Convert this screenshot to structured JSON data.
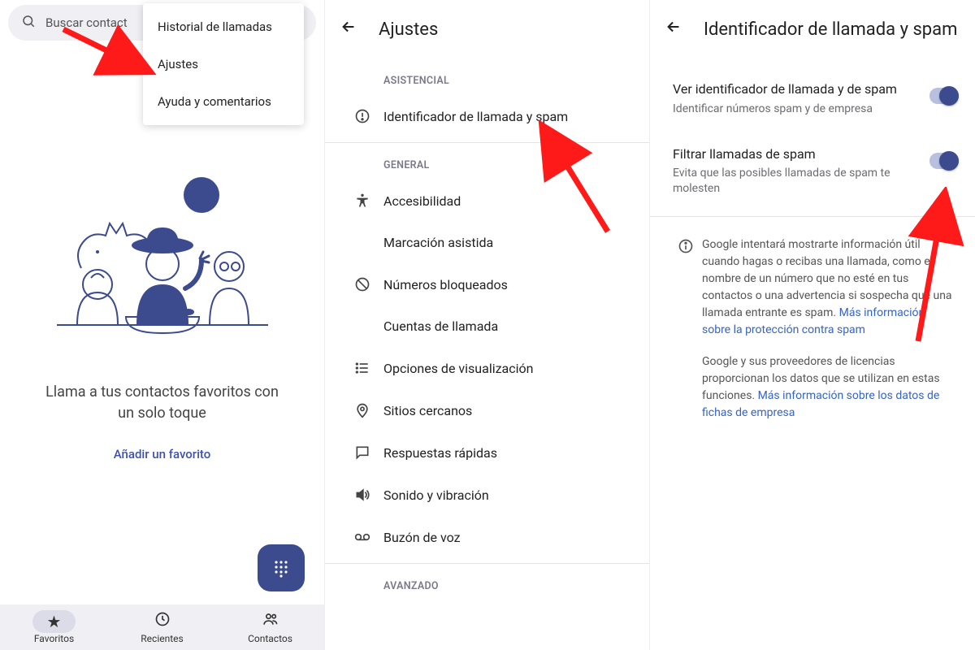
{
  "panel1": {
    "search_placeholder": "Buscar contact",
    "menu": {
      "history": "Historial de llamadas",
      "settings": "Ajustes",
      "help": "Ayuda y comentarios"
    },
    "favorites_message": "Llama a tus contactos favoritos con un solo toque",
    "add_favorite": "Añadir un favorito",
    "nav": {
      "favorites": "Favoritos",
      "recent": "Recientes",
      "contacts": "Contactos"
    }
  },
  "panel2": {
    "title": "Ajustes",
    "sections": {
      "assist": "ASISTENCIAL",
      "general": "GENERAL",
      "advanced": "AVANZADO"
    },
    "items": {
      "caller_id_spam": "Identificador de llamada y spam",
      "accessibility": "Accesibilidad",
      "assisted_dialing": "Marcación asistida",
      "blocked_numbers": "Números bloqueados",
      "calling_accounts": "Cuentas de llamada",
      "display_options": "Opciones de visualización",
      "nearby_places": "Sitios cercanos",
      "quick_responses": "Respuestas rápidas",
      "sound_vibration": "Sonido y vibración",
      "voicemail": "Buzón de voz"
    }
  },
  "panel3": {
    "title": "Identificador de llamada y spam",
    "toggle1": {
      "title": "Ver identificador de llamada y de spam",
      "sub": "Identificar números spam y de empresa"
    },
    "toggle2": {
      "title": "Filtrar llamadas de spam",
      "sub": "Evita que las posibles llamadas de spam te molesten"
    },
    "info": {
      "p1a": "Google intentará mostrarte información útil cuando hagas o recibas una llamada, como el nombre de un número que no esté en tus contactos o una advertencia si sospecha que una llamada entrante es spam. ",
      "p1_link": "Más información sobre la protección contra spam",
      "p2a": "Google y sus proveedores de licencias proporcionan los datos que se utilizan en estas funciones. ",
      "p2_link": "Más información sobre los datos de fichas de empresa"
    }
  }
}
